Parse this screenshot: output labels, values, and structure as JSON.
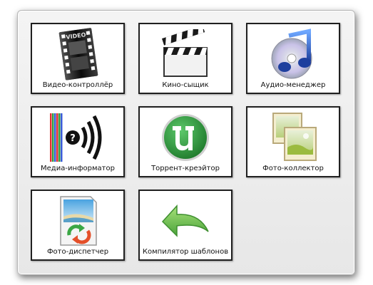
{
  "tiles": [
    {
      "label": "Видео-контроллёр",
      "icon": "video-filmstrip-icon"
    },
    {
      "label": "Кино-сыщик",
      "icon": "clapperboard-icon"
    },
    {
      "label": "Аудио-менеджер",
      "icon": "music-note-disc-icon"
    },
    {
      "label": "Медиа-информатор",
      "icon": "media-info-icon"
    },
    {
      "label": "Торрент-креэйтор",
      "icon": "utorrent-icon"
    },
    {
      "label": "Фото-коллектор",
      "icon": "photo-frames-icon"
    },
    {
      "label": "Фото-диспетчер",
      "icon": "photo-document-icon"
    },
    {
      "label": "Компилятор шаблонов",
      "icon": "undo-arrow-icon"
    }
  ],
  "video_icon_text": "VIDEO",
  "colors": {
    "tile_border": "#202020",
    "panel_bg": "#ececec",
    "utorrent_green": "#2e8b3a",
    "arrow_green": "#6cc24a"
  }
}
